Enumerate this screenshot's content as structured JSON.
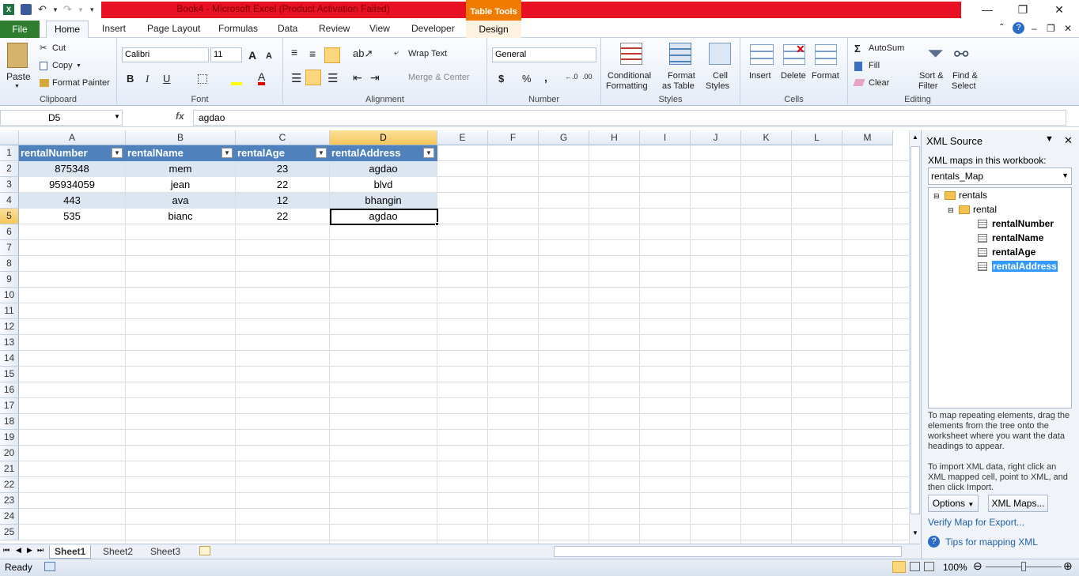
{
  "window": {
    "title": "Book4 - Microsoft Excel (Product Activation Failed)",
    "context_tab": "Table Tools"
  },
  "tabs": {
    "file": "File",
    "home": "Home",
    "insert": "Insert",
    "page_layout": "Page Layout",
    "formulas": "Formulas",
    "data": "Data",
    "review": "Review",
    "view": "View",
    "developer": "Developer",
    "design": "Design"
  },
  "ribbon": {
    "clipboard": {
      "paste": "Paste",
      "cut": "Cut",
      "copy": "Copy",
      "format_painter": "Format Painter",
      "label": "Clipboard"
    },
    "font": {
      "name": "Calibri",
      "size": "11",
      "label": "Font",
      "bold": "B",
      "italic": "I",
      "underline": "U"
    },
    "alignment": {
      "wrap": "Wrap Text",
      "merge": "Merge & Center",
      "label": "Alignment"
    },
    "number": {
      "format": "General",
      "currency": "$",
      "percent": "%",
      "comma": ",",
      "label": "Number"
    },
    "styles": {
      "conditional": "Conditional",
      "conditional2": "Formatting",
      "format_table": "Format",
      "format_table2": "as Table",
      "cell_styles": "Cell",
      "cell_styles2": "Styles",
      "label": "Styles"
    },
    "cells": {
      "insert": "Insert",
      "delete": "Delete",
      "format": "Format",
      "label": "Cells"
    },
    "editing": {
      "autosum": "AutoSum",
      "fill": "Fill",
      "clear": "Clear",
      "sort": "Sort &",
      "sort2": "Filter",
      "find": "Find &",
      "find2": "Select",
      "label": "Editing"
    }
  },
  "formula": {
    "namebox": "D5",
    "fx": "fx",
    "value": "agdao"
  },
  "columns": [
    "A",
    "B",
    "C",
    "D",
    "E",
    "F",
    "G",
    "H",
    "I",
    "J",
    "K",
    "L",
    "M"
  ],
  "rows": [
    "1",
    "2",
    "3",
    "4",
    "5",
    "6",
    "7",
    "8",
    "9",
    "10",
    "11",
    "12",
    "13",
    "14",
    "15",
    "16",
    "17",
    "18",
    "19",
    "20",
    "21",
    "22",
    "23",
    "24",
    "25"
  ],
  "table": {
    "headers": [
      "rentalNumber",
      "rentalName",
      "rentalAge",
      "rentalAddress"
    ],
    "data": [
      [
        "875348",
        "mem",
        "23",
        "agdao"
      ],
      [
        "95934059",
        "jean",
        "22",
        "blvd"
      ],
      [
        "443",
        "ava",
        "12",
        "bhangin"
      ],
      [
        "535",
        "bianc",
        "22",
        "agdao"
      ]
    ]
  },
  "sheets": [
    "Sheet1",
    "Sheet2",
    "Sheet3"
  ],
  "status": {
    "ready": "Ready",
    "zoom": "100%"
  },
  "xml_pane": {
    "title": "XML Source",
    "maps_label": "XML maps in this workbook:",
    "map_name": "rentals_Map",
    "tree": {
      "root": "rentals",
      "child": "rental",
      "fields": [
        "rentalNumber",
        "rentalName",
        "rentalAge",
        "rentalAddress"
      ]
    },
    "help1": "To map repeating elements, drag the elements from the tree onto the worksheet where you want the data headings to appear.",
    "help2": "To import XML data, right click an XML mapped cell, point to XML, and then click Import.",
    "options": "Options",
    "xml_maps": "XML Maps...",
    "verify": "Verify Map for Export...",
    "tips": "Tips for mapping XML"
  }
}
